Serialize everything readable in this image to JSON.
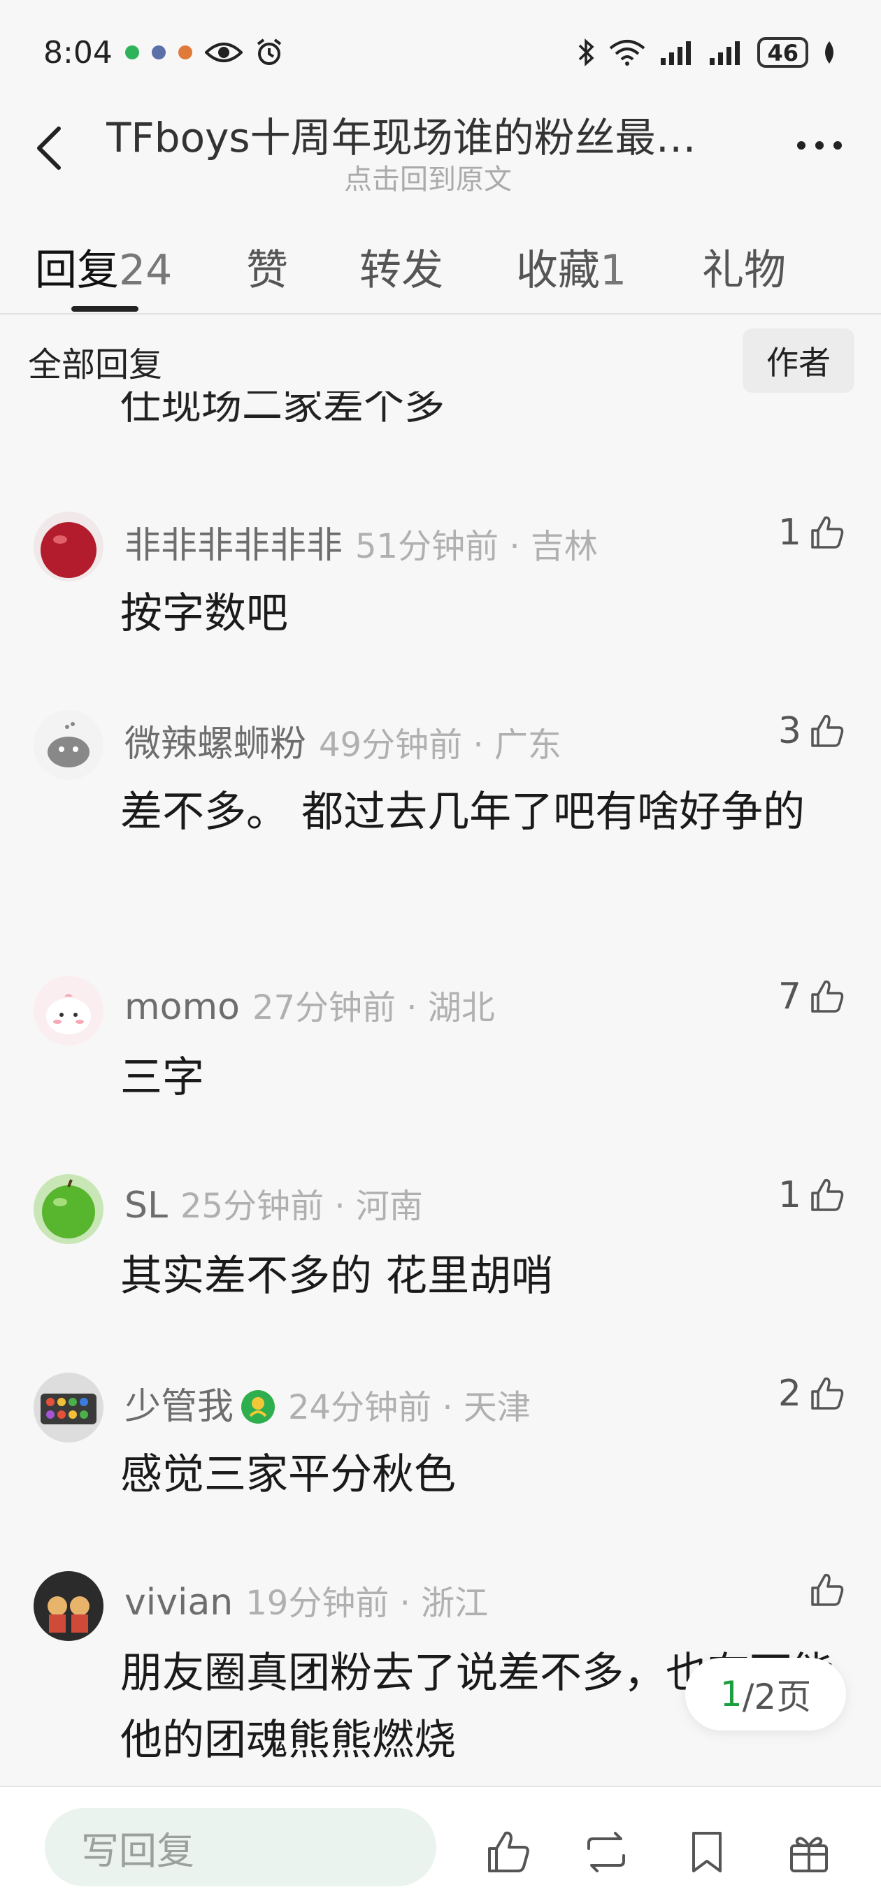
{
  "status_bar": {
    "time": "8:04",
    "battery": "46"
  },
  "header": {
    "title": "TFboys十周年现场谁的粉丝最…",
    "subtitle": "点击回到原文"
  },
  "tabs": [
    {
      "label": "回复",
      "count": "24"
    },
    {
      "label": "赞",
      "count": ""
    },
    {
      "label": "转发",
      "count": ""
    },
    {
      "label": "收藏",
      "count": "1"
    },
    {
      "label": "礼物",
      "count": ""
    }
  ],
  "filter": {
    "label": "全部回复",
    "author_button": "作者"
  },
  "partial_comment_text": "仕现场二家差个多",
  "comments": [
    {
      "name": "非非非非非非",
      "time": "51分钟前 · 吉林",
      "likes": "1",
      "text": "按字数吧"
    },
    {
      "name": "微辣螺蛳粉",
      "time": "49分钟前 · 广东",
      "likes": "3",
      "text": "差不多。 都过去几年了吧有啥好争的"
    },
    {
      "name": "momo",
      "time": "27分钟前 · 湖北",
      "likes": "7",
      "text": "三字"
    },
    {
      "name": "SL",
      "time": "25分钟前 · 河南",
      "likes": "1",
      "text": "其实差不多的 花里胡哨"
    },
    {
      "name": "少管我",
      "time": "24分钟前 · 天津",
      "likes": "2",
      "text": "感觉三家平分秋色"
    },
    {
      "name": "vivian",
      "time": "19分钟前 · 浙江",
      "likes": "",
      "text": "朋友圈真团粉去了说差不多，也有可能他的团魂熊熊燃烧"
    }
  ],
  "pagination": {
    "current": "1",
    "total": "/2页"
  },
  "bottom_bar": {
    "reply_placeholder": "写回复"
  },
  "colors": {
    "accent": "#1b9e3e",
    "input_bg": "#eaf3ee"
  }
}
